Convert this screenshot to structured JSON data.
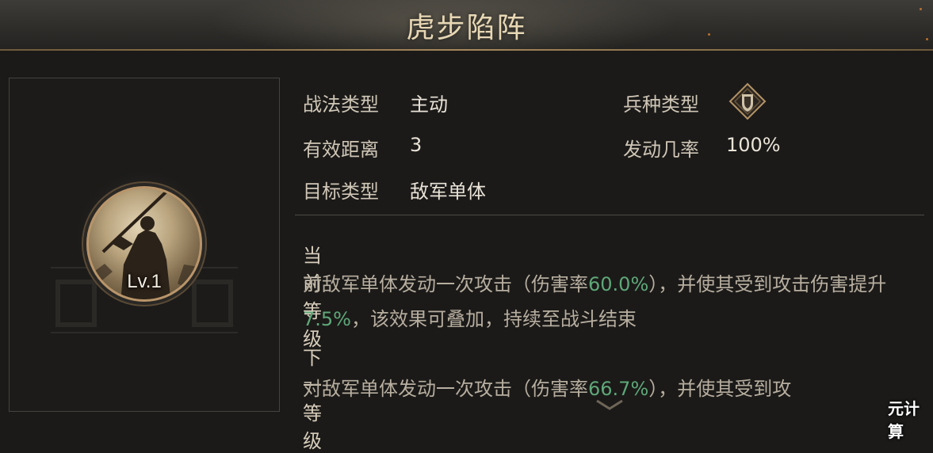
{
  "title": "虎步陷阵",
  "portrait": {
    "level": "Lv.1"
  },
  "stats": {
    "tactic_type_label": "战法类型",
    "tactic_type_value": "主动",
    "troop_type_label": "兵种类型",
    "troop_type_icon": "shield-diamond-icon",
    "range_label": "有效距离",
    "range_value": "3",
    "trigger_rate_label": "发动几率",
    "trigger_rate_value": "100%",
    "target_type_label": "目标类型",
    "target_type_value": "敌军单体"
  },
  "current_level": {
    "heading": "当前等级",
    "desc_part1": "对敌军单体发动一次攻击（伤害率",
    "damage_rate": "60.0%",
    "desc_part2": "），并使其受到攻击伤害提升",
    "boost": "7.5%",
    "desc_part3": "，该效果可叠加，持续至战斗结束"
  },
  "next_level": {
    "heading": "下一等级",
    "desc_part1": "对敌军单体发动一次攻击（伤害率",
    "damage_rate": "66.7%",
    "desc_part2": "），并使其受到攻"
  },
  "watermark": "元计算",
  "colors": {
    "highlight": "#5fa778",
    "gold": "#b9956a"
  }
}
